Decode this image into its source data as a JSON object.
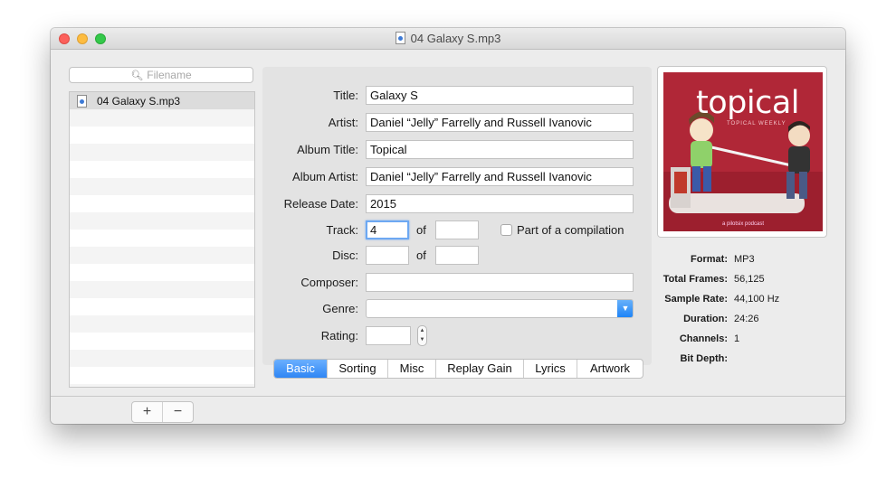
{
  "window": {
    "title": "04 Galaxy S.mp3"
  },
  "sidebar": {
    "search_placeholder": "Filename",
    "files": [
      {
        "name": "04 Galaxy S.mp3",
        "selected": true
      }
    ],
    "add_label": "+",
    "remove_label": "−"
  },
  "form": {
    "labels": {
      "title": "Title:",
      "artist": "Artist:",
      "album_title": "Album Title:",
      "album_artist": "Album Artist:",
      "release_date": "Release Date:",
      "track": "Track:",
      "disc": "Disc:",
      "composer": "Composer:",
      "genre": "Genre:",
      "rating": "Rating:",
      "of": "of",
      "compilation": "Part of a compilation"
    },
    "values": {
      "title": "Galaxy S",
      "artist": "Daniel “Jelly” Farrelly and Russell Ivanovic",
      "album_title": "Topical",
      "album_artist": "Daniel “Jelly” Farrelly and Russell Ivanovic",
      "release_date": "2015",
      "track": "4",
      "track_of": "",
      "disc": "",
      "disc_of": "",
      "composer": "",
      "genre": "",
      "rating": "",
      "compilation_checked": false
    },
    "tabs": [
      "Basic",
      "Sorting",
      "Misc",
      "Replay Gain",
      "Lyrics",
      "Artwork"
    ],
    "active_tab": "Basic"
  },
  "artwork": {
    "title": "topical",
    "subtitle": "TOPICAL WEEKLY",
    "footer": "a pilotsix podcast"
  },
  "info": {
    "labels": {
      "format": "Format:",
      "total_frames": "Total Frames:",
      "sample_rate": "Sample Rate:",
      "duration": "Duration:",
      "channels": "Channels:",
      "bit_depth": "Bit Depth:"
    },
    "values": {
      "format": "MP3",
      "total_frames": "56,125",
      "sample_rate": "44,100 Hz",
      "duration": "24:26",
      "channels": "1",
      "bit_depth": ""
    }
  },
  "colors": {
    "accent": "#2f86f4",
    "close": "#fc605b",
    "minimize": "#fdbc40",
    "maximize": "#34c84a",
    "artwork_bg": "#b02737"
  }
}
